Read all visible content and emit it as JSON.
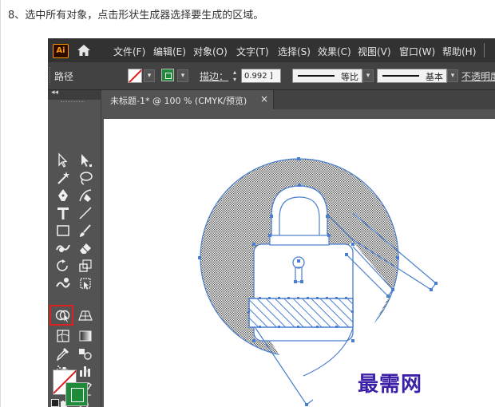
{
  "caption": "8、选中所有对象，点击形状生成器选择要生成的区域。",
  "app": {
    "logo": "Ai",
    "menu": [
      "文件(F)",
      "编辑(E)",
      "对象(O)",
      "文字(T)",
      "选择(S)",
      "效果(C)",
      "视图(V)",
      "窗口(W)",
      "帮助(H)"
    ],
    "control_bar": {
      "object_type": "路径",
      "fill_color": "#ffffff",
      "stroke_color": "#1f8b3a",
      "stroke_label": "描边：",
      "stroke_weight": "0.992 ]",
      "profile_label": "等比",
      "brush_label": "基本",
      "opacity_label": "不透明度"
    },
    "document_tab": {
      "title": "未标题-1* @ 100 % (CMYK/预览)",
      "close": "×"
    },
    "toolbar": {
      "collapse": "◂◂",
      "highlighted_tool": "shape-builder-tool"
    },
    "accent_color": "#4a7fd0",
    "highlight_color": "#e02020"
  },
  "watermark": "最需网"
}
